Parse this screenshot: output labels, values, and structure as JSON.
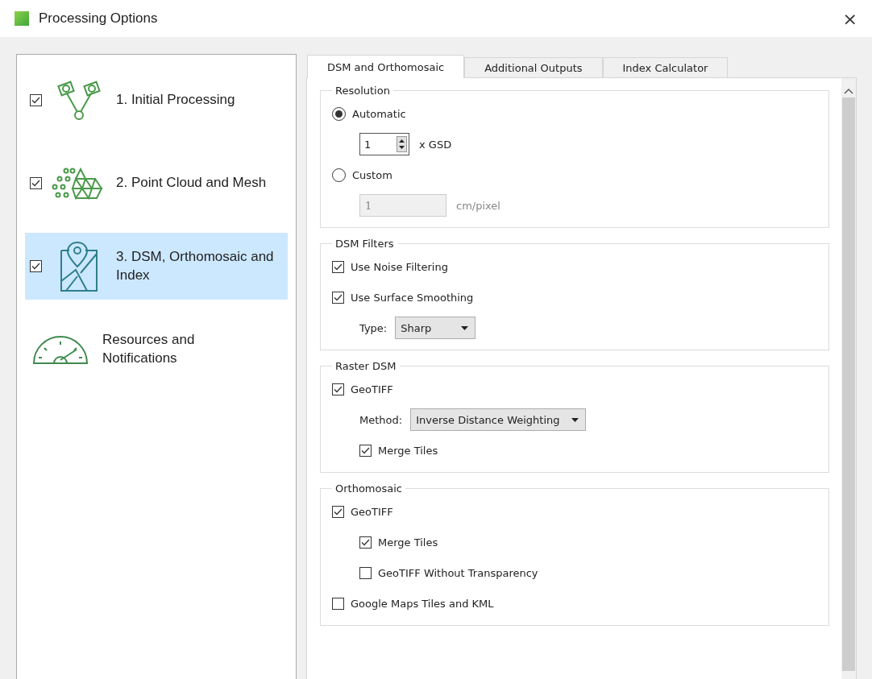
{
  "window": {
    "title": "Processing Options",
    "close": "×"
  },
  "sidebar": {
    "items": [
      {
        "kind": "step",
        "label": "1. Initial Processing",
        "checked": true,
        "selected": false
      },
      {
        "kind": "step",
        "label": "2. Point Cloud and Mesh",
        "checked": true,
        "selected": false
      },
      {
        "kind": "step",
        "label": "3. DSM, Orthomosaic and Index",
        "checked": true,
        "selected": true
      },
      {
        "kind": "settings",
        "label": "Resources and Notifications",
        "selected": false
      }
    ]
  },
  "tabs": [
    {
      "label": "DSM and Orthomosaic",
      "selected": true
    },
    {
      "label": "Additional Outputs",
      "selected": false
    },
    {
      "label": "Index Calculator",
      "selected": false
    }
  ],
  "groups": [
    {
      "title": "Resolution",
      "controls": [
        {
          "kind": "radio",
          "label": "Automatic",
          "selected": true,
          "children": [
            {
              "kind": "spin",
              "value": "1",
              "unit": "x GSD"
            }
          ]
        },
        {
          "kind": "radio",
          "label": "Custom",
          "selected": false,
          "children": [
            {
              "kind": "field",
              "value": "1",
              "unit": "cm/pixel",
              "disabled": true
            }
          ]
        }
      ]
    },
    {
      "title": "DSM Filters",
      "controls": [
        {
          "kind": "checkbox",
          "label": "Use Noise Filtering",
          "checked": true
        },
        {
          "kind": "checkbox",
          "label": "Use Surface Smoothing",
          "checked": true,
          "children": [
            {
              "kind": "select",
              "label": "Type:",
              "value": "Sharp"
            }
          ]
        }
      ]
    },
    {
      "title": "Raster DSM",
      "controls": [
        {
          "kind": "checkbox",
          "label": "GeoTIFF",
          "checked": true,
          "children": [
            {
              "kind": "select",
              "label": "Method:",
              "value": "Inverse Distance Weighting"
            },
            {
              "kind": "checkbox",
              "label": "Merge Tiles",
              "checked": true
            }
          ]
        }
      ]
    },
    {
      "title": "Orthomosaic",
      "controls": [
        {
          "kind": "checkbox",
          "label": "GeoTIFF",
          "checked": true,
          "children": [
            {
              "kind": "checkbox",
              "label": "Merge Tiles",
              "checked": true
            },
            {
              "kind": "checkbox",
              "label": "GeoTIFF Without Transparency",
              "checked": false
            }
          ]
        },
        {
          "kind": "checkbox",
          "label": "Google Maps Tiles and KML",
          "checked": false
        }
      ]
    }
  ]
}
